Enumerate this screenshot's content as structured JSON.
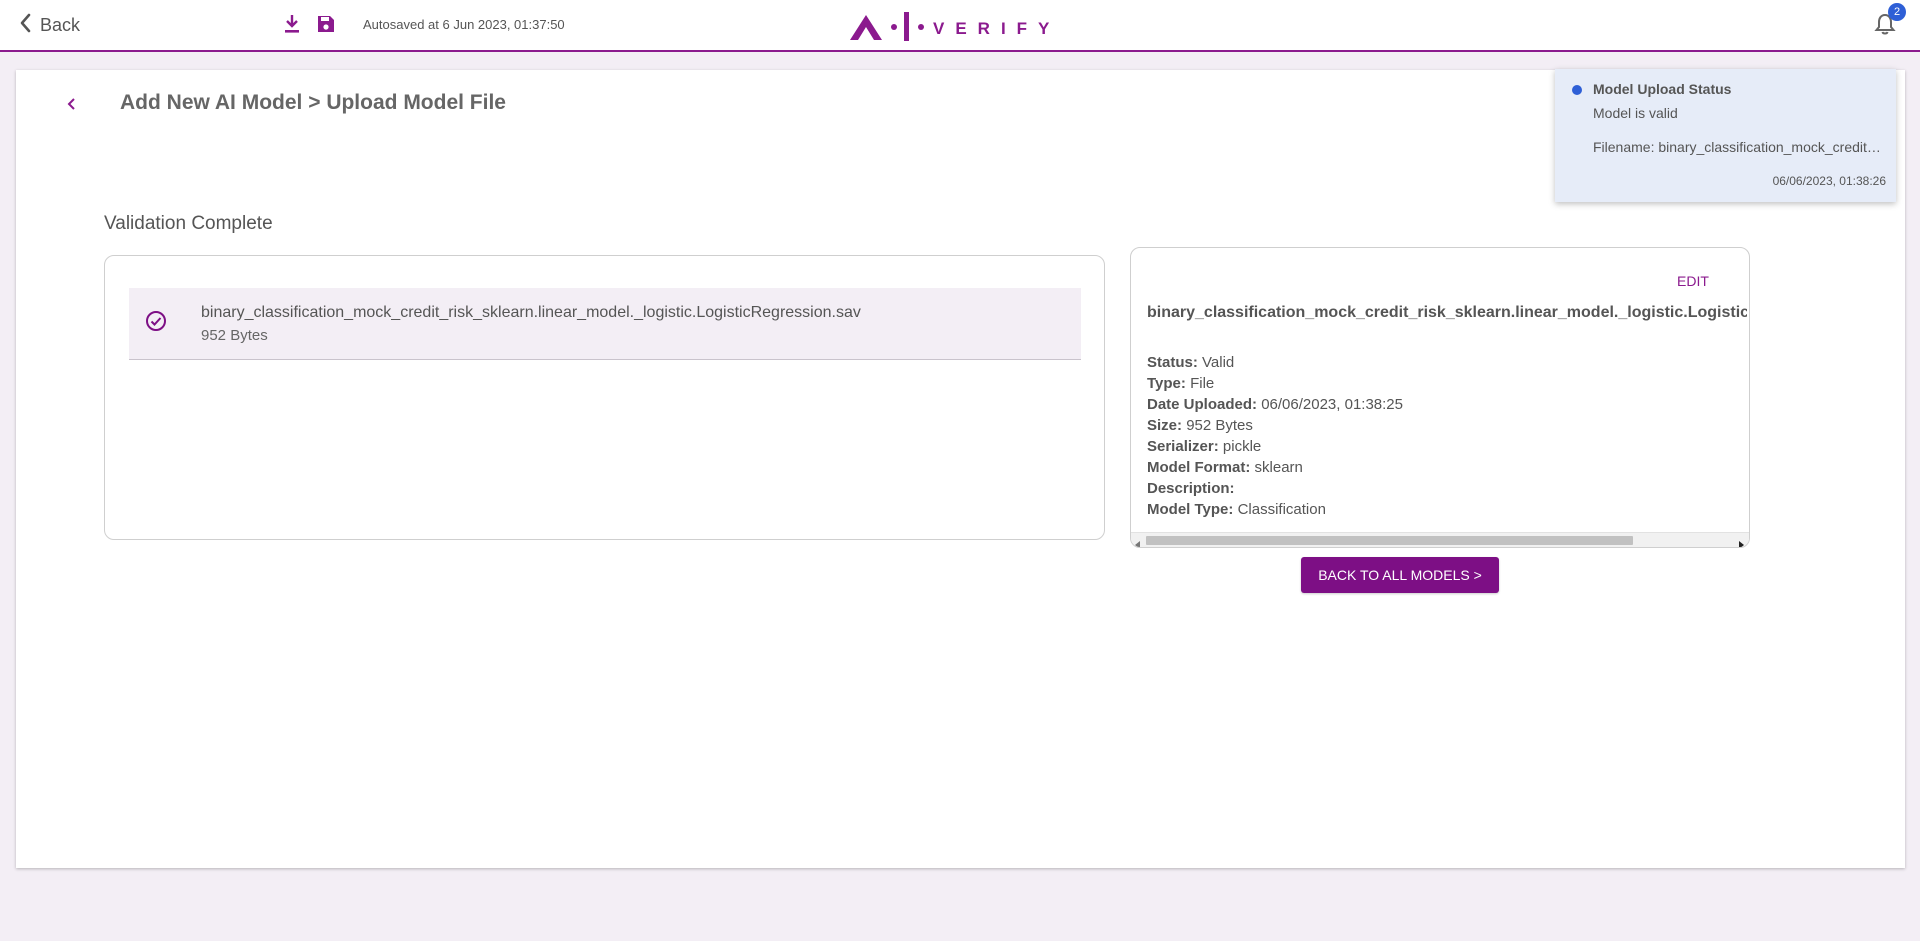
{
  "header": {
    "back_label": "Back",
    "autosave_text": "Autosaved at 6 Jun 2023, 01:37:50",
    "logo_text": "VERIFY",
    "notification_count": "2",
    "brand_color": "#8b1a8e"
  },
  "page": {
    "title": "Add New AI Model > Upload Model File",
    "section_title": "Validation Complete"
  },
  "file_list": [
    {
      "name": "binary_classification_mock_credit_risk_sklearn.linear_model._logistic.LogisticRegression.sav",
      "size": "952 Bytes",
      "status_icon": "check-circle-icon"
    }
  ],
  "details": {
    "edit_label": "EDIT",
    "title": "binary_classification_mock_credit_risk_sklearn.linear_model._logistic.LogisticRegression.sav",
    "fields": [
      {
        "key": "Status:",
        "value": "Valid"
      },
      {
        "key": "Type:",
        "value": "File"
      },
      {
        "key": "Date Uploaded:",
        "value": "06/06/2023, 01:38:25"
      },
      {
        "key": "Size:",
        "value": "952 Bytes"
      },
      {
        "key": "Serializer:",
        "value": "pickle"
      },
      {
        "key": "Model Format:",
        "value": "sklearn"
      },
      {
        "key": "Description:",
        "value": ""
      },
      {
        "key": "Model Type:",
        "value": "Classification"
      }
    ]
  },
  "actions": {
    "back_to_all_label": "BACK TO ALL MODELS >"
  },
  "notification": {
    "title": "Model Upload Status",
    "message": "Model is valid",
    "filename": "Filename: binary_classification_mock_credit_risk_sklearn.linear_model._logistic.LogisticRegression.sav",
    "timestamp": "06/06/2023, 01:38:26"
  }
}
